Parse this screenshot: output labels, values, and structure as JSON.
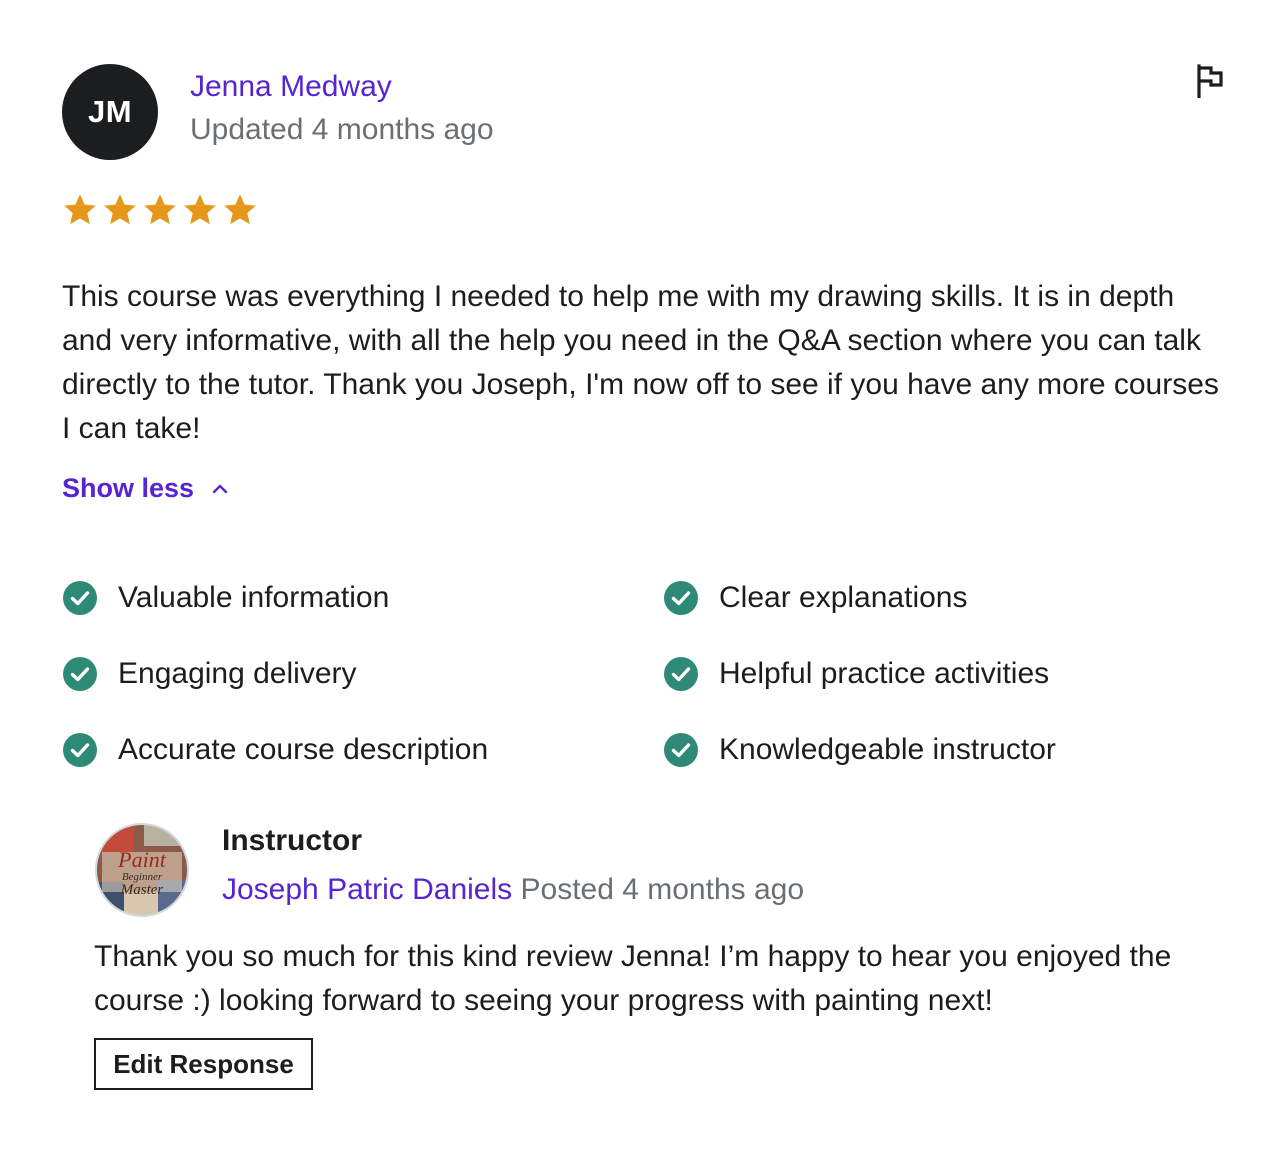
{
  "review": {
    "avatar_initials": "JM",
    "reviewer_name": "Jenna Medway",
    "updated": "Updated 4 months ago",
    "rating": 5,
    "rating_max": 5,
    "star_color": "#e59819",
    "text": "This course was everything I needed to help me with my drawing skills. It is in depth and very informative, with all the help you need in the Q&A section where you can talk directly to the tutor. Thank you Joseph, I'm now off to see if you have any more courses I can take!",
    "toggle_label": "Show less",
    "toggle_icon": "chevron-up-icon",
    "flag_icon": "flag-icon"
  },
  "features": {
    "check_color": "#2e8a76",
    "items": [
      "Valuable information",
      "Clear explanations",
      "Engaging delivery",
      "Helpful practice activities",
      "Accurate course description",
      "Knowledgeable instructor"
    ]
  },
  "response": {
    "title": "Instructor",
    "instructor_name": "Joseph Patric Daniels",
    "posted": "Posted 4 months ago",
    "text": "Thank you so much for this kind review Jenna! I’m happy to hear you enjoyed the course :) looking forward to seeing your progress with painting next!",
    "edit_label": "Edit Response",
    "avatar_logo_text": [
      "Paint",
      "Beginner",
      "Master"
    ]
  },
  "colors": {
    "accent": "#5624d0",
    "muted": "#6a6f73",
    "text": "#1c1d1f"
  }
}
